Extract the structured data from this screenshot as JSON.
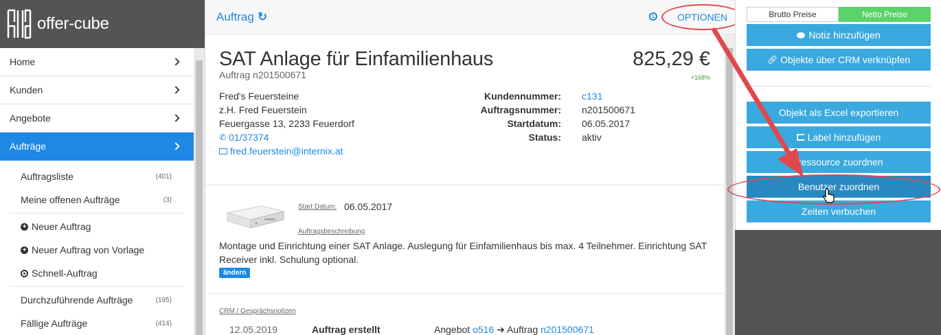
{
  "brand": {
    "name": "offer-cube"
  },
  "sidebar": {
    "items": [
      {
        "label": "Home"
      },
      {
        "label": "Kunden"
      },
      {
        "label": "Angebote"
      },
      {
        "label": "Aufträge"
      }
    ],
    "sub_items": [
      {
        "label": "Auftragsliste",
        "count": "(401)"
      },
      {
        "label": "Meine offenen Aufträge",
        "count": "(3)"
      },
      {
        "label": "Neuer Auftrag"
      },
      {
        "label": "Neuer Auftrag von Vorlage"
      },
      {
        "label": "Schnell-Auftrag"
      },
      {
        "label": "Durchzuführende Aufträge",
        "count": "(195)"
      },
      {
        "label": "Fällige Aufträge",
        "count": "(414)"
      }
    ]
  },
  "topbar": {
    "title": "Auftrag",
    "options": "OPTIONEN"
  },
  "order": {
    "title": "SAT Anlage für Einfamilienhaus",
    "number": "Auftrag n201500671",
    "price": "825,29 €",
    "price_change": "+168%",
    "address": {
      "company": "Fred's Feuersteine",
      "contact": "z.H. Fred Feuerstein",
      "street": "Feuergasse 13, 2233 Feuerdorf",
      "phone": "01/37374",
      "email": "fred.feuerstein@internix.at"
    },
    "meta": [
      {
        "key": "Kundennummer:",
        "value": "c131"
      },
      {
        "key": "Auftragsnummer:",
        "value": "n201500671"
      },
      {
        "key": "Startdatum:",
        "value": "06.05.2017"
      },
      {
        "key": "Status:",
        "value": "aktiv"
      }
    ]
  },
  "description": {
    "start_label": "Start Datum:",
    "start_value": "06.05.2017",
    "desc_label": "Auftragsbeschreibung",
    "text": "Montage und Einrichtung einer SAT Anlage. Auslegung für Einfamilienhaus bis max. 4 Teilnehmer. Einrichtung SAT Receiver inkl. Schulung optional.",
    "edit_label": "ändern"
  },
  "crm": {
    "label": "CRM / Gesprächsnotizen",
    "row": {
      "date": "12.05.2019",
      "action": "Auftrag erstellt",
      "offer_text": "Angebot",
      "offer_id": "o516",
      "order_text": "Auftrag",
      "order_id": "n201500671"
    }
  },
  "right_panel": {
    "brutto": "Brutto Preise",
    "netto": "Netto Preise",
    "buttons": [
      "Notiz hinzufügen",
      "Objekte über CRM verknüpfen",
      "Objekt als Excel exportieren",
      "Label hinzufügen",
      "Ressource zuordnen",
      "Benutzer zuordnen",
      "Zeiten verbuchen"
    ]
  },
  "colors": {
    "accent": "#1e88e5",
    "button": "#3aa9df",
    "highlight": "#e0484d",
    "netto": "#5cd36a"
  }
}
